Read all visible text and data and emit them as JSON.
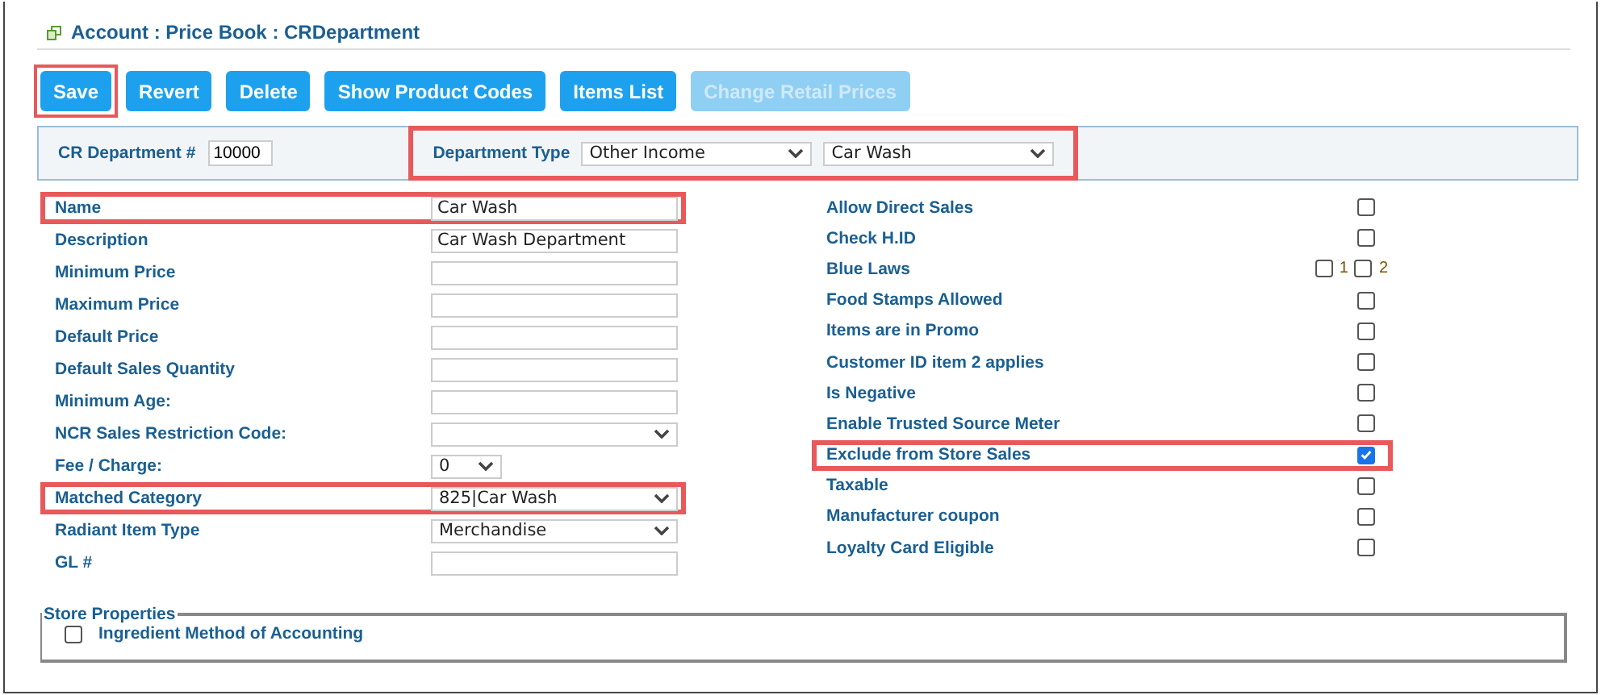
{
  "breadcrumb": "Account : Price Book : CRDepartment",
  "buttons": [
    {
      "label": "Save",
      "disabled": false,
      "highlighted": true
    },
    {
      "label": "Revert",
      "disabled": false,
      "highlighted": false
    },
    {
      "label": "Delete",
      "disabled": false,
      "highlighted": false
    },
    {
      "label": "Show Product Codes",
      "disabled": false,
      "highlighted": false
    },
    {
      "label": "Items List",
      "disabled": false,
      "highlighted": false
    },
    {
      "label": "Change Retail Prices",
      "disabled": true,
      "highlighted": false
    }
  ],
  "header": {
    "cr_department_label": "CR Department #",
    "cr_department_value": "10000",
    "department_type_label": "Department Type",
    "department_type_values": [
      "Other Income",
      "Car Wash"
    ],
    "highlighted": true
  },
  "fields": [
    {
      "label": "Name",
      "kind": "text",
      "value": "Car Wash",
      "highlighted": true
    },
    {
      "label": "Description",
      "kind": "text",
      "value": "Car Wash Department",
      "highlighted": false
    },
    {
      "label": "Minimum Price",
      "kind": "text",
      "highlighted": false
    },
    {
      "label": "Maximum Price",
      "kind": "text",
      "highlighted": false
    },
    {
      "label": "Default Price",
      "kind": "text",
      "highlighted": false
    },
    {
      "label": "Default Sales Quantity",
      "kind": "text",
      "highlighted": false
    },
    {
      "label": "Minimum Age:",
      "kind": "text",
      "highlighted": false
    },
    {
      "label": "NCR Sales Restriction Code:",
      "kind": "select",
      "highlighted": false
    },
    {
      "label": "Fee / Charge:",
      "kind": "short_select",
      "value": "0",
      "highlighted": false
    },
    {
      "label": "Matched Category",
      "kind": "select",
      "value": "825|Car Wash",
      "highlighted": true
    },
    {
      "label": "Radiant Item Type",
      "kind": "select",
      "value": "Merchandise",
      "highlighted": false
    },
    {
      "label": "GL #",
      "kind": "text",
      "highlighted": false
    }
  ],
  "flags": [
    {
      "label": "Allow Direct Sales",
      "checked": false,
      "highlighted": false
    },
    {
      "label": "Check H.ID",
      "checked": false,
      "highlighted": false
    },
    {
      "label": "Blue Laws",
      "highlighted": false,
      "options": [
        {
          "label": "1",
          "checked": false
        },
        {
          "label": "2",
          "checked": false
        }
      ]
    },
    {
      "label": "Food Stamps Allowed",
      "checked": false,
      "highlighted": false
    },
    {
      "label": "Items are in Promo",
      "checked": false,
      "highlighted": false
    },
    {
      "label": "Customer ID item 2 applies",
      "checked": false,
      "highlighted": false
    },
    {
      "label": "Is Negative",
      "checked": false,
      "highlighted": false
    },
    {
      "label": "Enable Trusted Source Meter",
      "checked": false,
      "highlighted": false
    },
    {
      "label": "Exclude from Store Sales",
      "checked": true,
      "highlighted": true
    },
    {
      "label": "Taxable",
      "checked": false,
      "highlighted": false
    },
    {
      "label": "Manufacturer coupon",
      "checked": false,
      "highlighted": false
    },
    {
      "label": "Loyalty Card Eligible",
      "checked": false,
      "highlighted": false
    }
  ],
  "store_properties": {
    "legend": "Store Properties",
    "items": [
      {
        "label": "Ingredient Method of Accounting",
        "checked": false
      }
    ]
  }
}
